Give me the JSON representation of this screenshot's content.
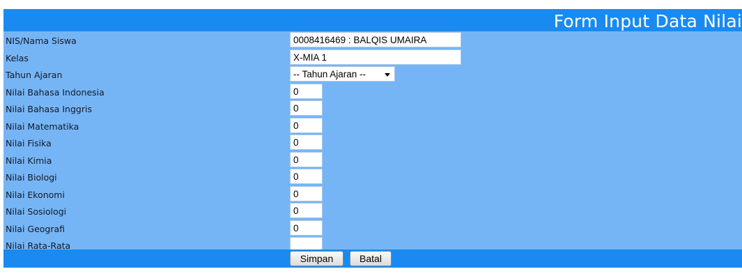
{
  "form": {
    "title": "Form Input Data Nilai",
    "fields": [
      {
        "label": "NIS/Nama Siswa",
        "value": "0008416469 : BALQIS UMAIRA"
      },
      {
        "label": "Kelas",
        "value": "X-MIA 1"
      },
      {
        "label": "Tahun Ajaran",
        "selected": "-- Tahun Ajaran --"
      },
      {
        "label": "Nilai Bahasa Indonesia",
        "value": "0"
      },
      {
        "label": "Nilai Bahasa Inggris",
        "value": "0"
      },
      {
        "label": "Nilai Matematika",
        "value": "0"
      },
      {
        "label": "Nilai Fisika",
        "value": "0"
      },
      {
        "label": "Nilai Kimia",
        "value": "0"
      },
      {
        "label": "Nilai Biologi",
        "value": "0"
      },
      {
        "label": "Nilai Ekonomi",
        "value": "0"
      },
      {
        "label": "Nilai Sosiologi",
        "value": "0"
      },
      {
        "label": "Nilai Geografi",
        "value": "0"
      },
      {
        "label": "Nilai Rata-Rata",
        "value": ""
      }
    ],
    "buttons": {
      "save": "Simpan",
      "cancel": "Batal"
    }
  },
  "colors": {
    "header_bg": "#1a8af0",
    "form_bg": "#76b5f5",
    "label_text": "#111a2a"
  }
}
